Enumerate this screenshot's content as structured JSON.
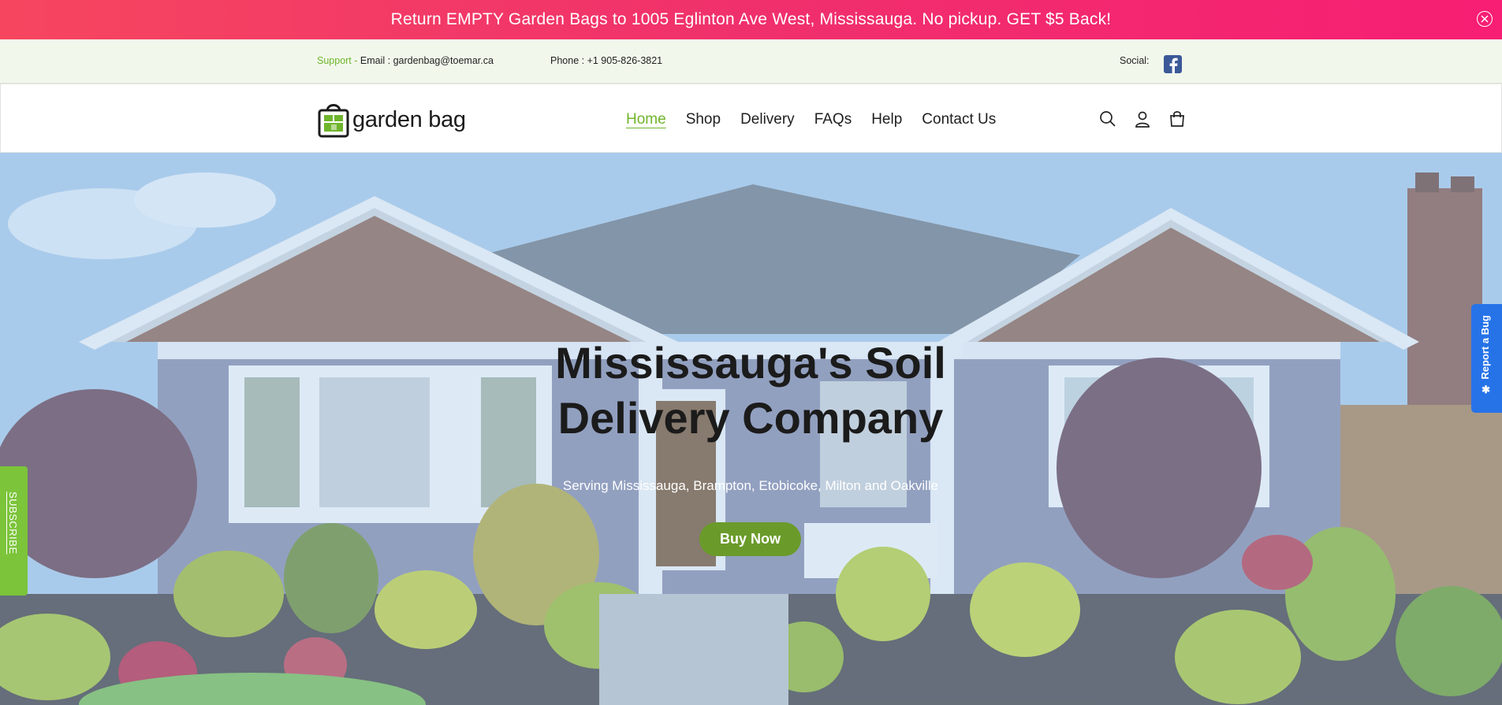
{
  "announcement": {
    "text": "Return EMPTY Garden Bags to 1005 Eglinton Ave West, Mississauga. No pickup. GET $5 Back!",
    "close_icon": "close-circle-icon"
  },
  "topbar": {
    "support_label": "Support - ",
    "email": "Email : gardenbag@toemar.ca",
    "phone": "Phone : +1 905-826-3821",
    "social_label": "Social:",
    "social_icon": "facebook-icon"
  },
  "header": {
    "logo_text": "garden bag",
    "nav": [
      "Home",
      "Shop",
      "Delivery",
      "FAQs",
      "Help",
      "Contact Us"
    ],
    "active_nav": "Home",
    "icons": [
      "search-icon",
      "account-icon",
      "cart-icon"
    ]
  },
  "hero": {
    "title_line1": "Mississauga's Soil",
    "title_line2": "Delivery Company",
    "subtitle": "Serving Mississauga, Brampton, Etobicoke, Milton and Oakville",
    "cta": "Buy Now"
  },
  "side_tabs": {
    "subscribe": "SUBSCRIBE",
    "report_bug": "Report a Bug"
  },
  "colors": {
    "accent_green": "#6fb52c",
    "cta_green": "#6a9b2a",
    "announcement_pink": "#f0306c",
    "bug_blue": "#2673e8"
  }
}
